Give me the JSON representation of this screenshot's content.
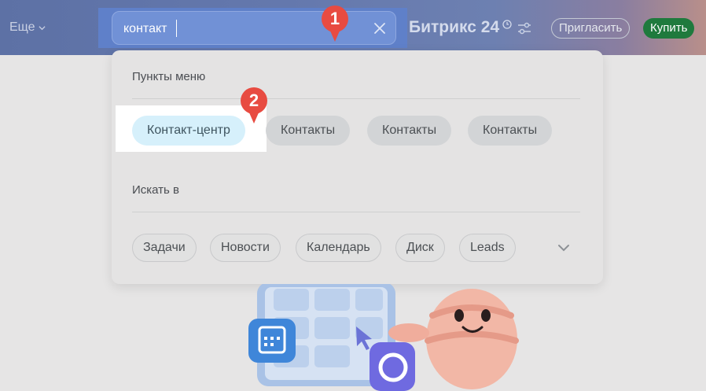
{
  "header": {
    "more_label": "Еще",
    "brand_name": "Битрикс 24",
    "invite_label": "Пригласить",
    "buy_label": "Купить"
  },
  "search": {
    "value": "контакт",
    "clear_icon": "close-icon"
  },
  "badges": [
    "1",
    "2"
  ],
  "dropdown": {
    "menu_section_title": "Пункты меню",
    "menu_items": [
      "Контакт-центр",
      "Контакты",
      "Контакты",
      "Контакты"
    ],
    "search_section_title": "Искать в",
    "search_in": [
      "Задачи",
      "Новости",
      "Календарь",
      "Диск",
      "Leads"
    ]
  },
  "colors": {
    "accent_green": "#1f7a3d",
    "badge_red": "#e84b41",
    "active_chip": "#d6f0fb"
  }
}
